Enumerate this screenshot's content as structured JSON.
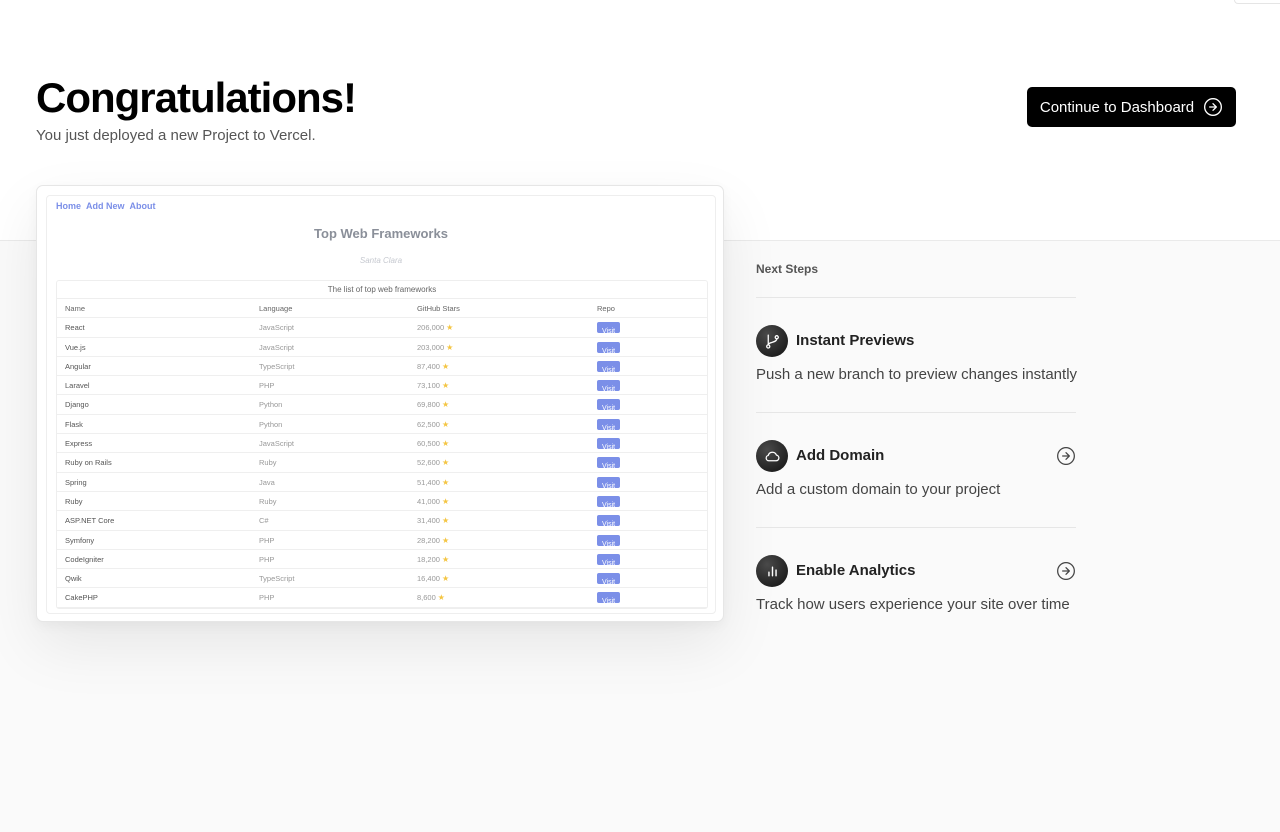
{
  "header": {
    "title": "Congratulations!",
    "subtitle": "You just deployed a new Project to Vercel.",
    "cta_label": "Continue to Dashboard"
  },
  "preview": {
    "nav": [
      "Home",
      "Add New",
      "About"
    ],
    "title": "Top Web Frameworks",
    "subtitle": "Santa Clara",
    "caption": "The list of top web frameworks",
    "columns": [
      "Name",
      "Language",
      "GitHub Stars",
      "Repo"
    ],
    "star_icon": "star-icon",
    "rows": [
      {
        "name": "React",
        "language": "JavaScript",
        "stars": "206,000",
        "repo": "Visit"
      },
      {
        "name": "Vue.js",
        "language": "JavaScript",
        "stars": "203,000",
        "repo": "Visit"
      },
      {
        "name": "Angular",
        "language": "TypeScript",
        "stars": "87,400",
        "repo": "Visit"
      },
      {
        "name": "Laravel",
        "language": "PHP",
        "stars": "73,100",
        "repo": "Visit"
      },
      {
        "name": "Django",
        "language": "Python",
        "stars": "69,800",
        "repo": "Visit"
      },
      {
        "name": "Flask",
        "language": "Python",
        "stars": "62,500",
        "repo": "Visit"
      },
      {
        "name": "Express",
        "language": "JavaScript",
        "stars": "60,500",
        "repo": "Visit"
      },
      {
        "name": "Ruby on Rails",
        "language": "Ruby",
        "stars": "52,600",
        "repo": "Visit"
      },
      {
        "name": "Spring",
        "language": "Java",
        "stars": "51,400",
        "repo": "Visit"
      },
      {
        "name": "Ruby",
        "language": "Ruby",
        "stars": "41,000",
        "repo": "Visit"
      },
      {
        "name": "ASP.NET Core",
        "language": "C#",
        "stars": "31,400",
        "repo": "Visit"
      },
      {
        "name": "Symfony",
        "language": "PHP",
        "stars": "28,200",
        "repo": "Visit"
      },
      {
        "name": "CodeIgniter",
        "language": "PHP",
        "stars": "18,200",
        "repo": "Visit"
      },
      {
        "name": "Qwik",
        "language": "TypeScript",
        "stars": "16,400",
        "repo": "Visit"
      },
      {
        "name": "CakePHP",
        "language": "PHP",
        "stars": "8,600",
        "repo": "Visit"
      }
    ]
  },
  "next_steps": {
    "label": "Next Steps",
    "items": [
      {
        "title": "Instant Previews",
        "description": "Push a new branch to preview changes instantly",
        "icon": "git-branch-icon",
        "has_arrow": false
      },
      {
        "title": "Add Domain",
        "description": "Add a custom domain to your project",
        "icon": "cloud-icon",
        "has_arrow": true
      },
      {
        "title": "Enable Analytics",
        "description": "Track how users experience your site over time",
        "icon": "bar-chart-icon",
        "has_arrow": true
      }
    ]
  },
  "colors": {
    "accent": "#7b8fe8",
    "button_bg": "#000000",
    "page_lower_bg": "#fafafa"
  }
}
